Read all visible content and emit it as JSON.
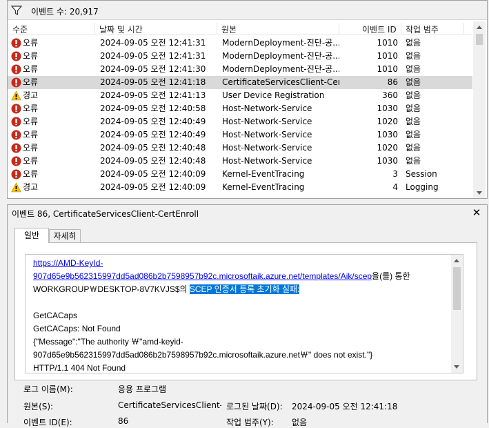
{
  "top": {
    "count_label": "이벤트 수: 20,917",
    "columns": {
      "level": "수준",
      "date": "날짜 및 시간",
      "source": "원본",
      "id": "이벤트 ID",
      "category": "작업 범주"
    },
    "rows": [
      {
        "type": "error",
        "level": "오류",
        "date": "2024-09-05 오전 12:41:31",
        "source": "ModernDeployment-진단-공...",
        "id": "1010",
        "category": "없음",
        "selected": false
      },
      {
        "type": "error",
        "level": "오류",
        "date": "2024-09-05 오전 12:41:31",
        "source": "ModernDeployment-진단-공...",
        "id": "1010",
        "category": "없음",
        "selected": false
      },
      {
        "type": "error",
        "level": "오류",
        "date": "2024-09-05 오전 12:41:30",
        "source": "ModernDeployment-진단-공...",
        "id": "1010",
        "category": "없음",
        "selected": false
      },
      {
        "type": "error",
        "level": "오류",
        "date": "2024-09-05 오전 12:41:18",
        "source": "CertificateServicesClient-Cert...",
        "id": "86",
        "category": "없음",
        "selected": true
      },
      {
        "type": "warning",
        "level": "경고",
        "date": "2024-09-05 오전 12:41:13",
        "source": "User Device Registration",
        "id": "360",
        "category": "없음",
        "selected": false
      },
      {
        "type": "error",
        "level": "오류",
        "date": "2024-09-05 오전 12:40:58",
        "source": "Host-Network-Service",
        "id": "1030",
        "category": "없음",
        "selected": false
      },
      {
        "type": "error",
        "level": "오류",
        "date": "2024-09-05 오전 12:40:49",
        "source": "Host-Network-Service",
        "id": "1020",
        "category": "없음",
        "selected": false
      },
      {
        "type": "error",
        "level": "오류",
        "date": "2024-09-05 오전 12:40:49",
        "source": "Host-Network-Service",
        "id": "1030",
        "category": "없음",
        "selected": false
      },
      {
        "type": "error",
        "level": "오류",
        "date": "2024-09-05 오전 12:40:48",
        "source": "Host-Network-Service",
        "id": "1020",
        "category": "없음",
        "selected": false
      },
      {
        "type": "error",
        "level": "오류",
        "date": "2024-09-05 오전 12:40:48",
        "source": "Host-Network-Service",
        "id": "1030",
        "category": "없음",
        "selected": false
      },
      {
        "type": "error",
        "level": "오류",
        "date": "2024-09-05 오전 12:40:09",
        "source": "Kernel-EventTracing",
        "id": "3",
        "category": "Session",
        "selected": false
      },
      {
        "type": "warning",
        "level": "경고",
        "date": "2024-09-05 오전 12:40:09",
        "source": "Kernel-EventTracing",
        "id": "4",
        "category": "Logging",
        "selected": false
      }
    ]
  },
  "detail": {
    "title": "이벤트 86, CertificateServicesClient-CertEnroll",
    "close": "✕",
    "tabs": {
      "general": "일반",
      "details": "자세히"
    },
    "message": {
      "link_line1": "https://AMD-KeyId-",
      "link_line2": "907d65e9b562315997dd5ad086b2b7598957b92c.microsoftaik.azure.net/templates/Aik/scep",
      "after_link": "을(를) 통한",
      "line3_prefix": "WORKGROUP￦DESKTOP-8V7KVJS$의 ",
      "line3_highlight": "SCEP 인증서 등록 초기화 실패:",
      "line5": "GetCACaps",
      "line6": "GetCACaps: Not Found",
      "line7": "{\"Message\":\"The authority ￦\"amd-keyid-",
      "line8": "907d65e9b562315997dd5ad086b2b7598957b92c.microsoftaik.azure.net￦\" does not exist.\"}",
      "line9": "HTTP/1.1 404 Not Found"
    },
    "props": {
      "log_name_label": "로그 이름(M):",
      "log_name_value": "응용 프로그램",
      "source_label": "원본(S):",
      "source_value": "CertificateServicesClient-Cer",
      "logged_label": "로그된 날짜(D):",
      "logged_value": "2024-09-05 오전 12:41:18",
      "event_id_label": "이벤트 ID(E):",
      "event_id_value": "86",
      "task_label": "작업 범주(Y):",
      "task_value": "없음"
    }
  },
  "colors": {
    "error": "#c42b1c",
    "warning": "#f7c600",
    "selection": "#0078d7",
    "link": "#0000ee"
  }
}
